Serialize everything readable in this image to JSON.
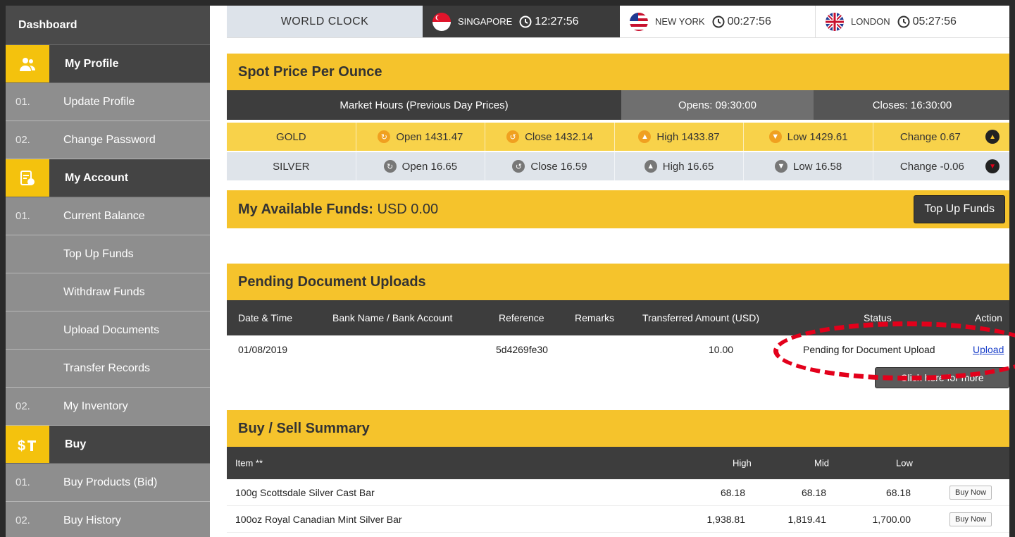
{
  "sidebar": {
    "dashboard": "Dashboard",
    "sections": [
      {
        "label": "My Profile",
        "icon": "user-group-icon"
      },
      {
        "label": "My Account",
        "icon": "account-document-icon"
      },
      {
        "label": "Buy",
        "icon": "dollar-bar-icon"
      }
    ],
    "profile_items": [
      {
        "num": "01.",
        "label": "Update Profile"
      },
      {
        "num": "02.",
        "label": "Change Password"
      }
    ],
    "account_items": [
      {
        "num": "01.",
        "label": "Current Balance"
      },
      {
        "num": "",
        "label": "Top Up Funds"
      },
      {
        "num": "",
        "label": "Withdraw Funds"
      },
      {
        "num": "",
        "label": "Upload Documents"
      },
      {
        "num": "",
        "label": "Transfer Records"
      },
      {
        "num": "02.",
        "label": "My Inventory"
      }
    ],
    "buy_items": [
      {
        "num": "01.",
        "label": "Buy Products (Bid)"
      },
      {
        "num": "02.",
        "label": "Buy History"
      }
    ]
  },
  "world_clock": {
    "title": "WORLD CLOCK",
    "cities": [
      {
        "name": "SINGAPORE",
        "time": "12:27:56"
      },
      {
        "name": "NEW YORK",
        "time": "00:27:56"
      },
      {
        "name": "LONDON",
        "time": "05:27:56"
      }
    ]
  },
  "spot": {
    "title": "Spot Price Per Ounce",
    "market_hours": "Market Hours (Previous Day Prices)",
    "opens": "Opens: 09:30:00",
    "closes": "Closes: 16:30:00",
    "gold": {
      "metal": "GOLD",
      "open": "Open 1431.47",
      "close": "Close 1432.14",
      "high": "High 1433.87",
      "low": "Low 1429.61",
      "change": "Change 0.67"
    },
    "silver": {
      "metal": "SILVER",
      "open": "Open 16.65",
      "close": "Close 16.59",
      "high": "High 16.65",
      "low": "Low 16.58",
      "change": "Change -0.06"
    }
  },
  "funds": {
    "label": "My Available Funds:",
    "value": "USD 0.00",
    "button": "Top Up Funds"
  },
  "pending": {
    "title": "Pending Document Uploads",
    "headers": [
      "Date & Time",
      "Bank Name / Bank Account",
      "Reference",
      "Remarks",
      "Transferred Amount (USD)",
      "Status",
      "Action"
    ],
    "row": {
      "date": "01/08/2019",
      "bank": "",
      "reference": "5d4269fe30",
      "remarks": "",
      "amount": "10.00",
      "status": "Pending for Document Upload",
      "action": "Upload"
    },
    "more_button": "Click here for more"
  },
  "buysell": {
    "title": "Buy / Sell Summary",
    "headers": [
      "Item **",
      "High",
      "Mid",
      "Low"
    ],
    "rows": [
      {
        "item": "100g Scottsdale Silver Cast Bar",
        "high": "68.18",
        "mid": "68.18",
        "low": "68.18",
        "action": "Buy Now"
      },
      {
        "item": "100oz Royal Canadian Mint Silver Bar",
        "high": "1,938.81",
        "mid": "1,819.41",
        "low": "1,700.00",
        "action": "Buy Now"
      }
    ]
  },
  "colors": {
    "accent": "#f5c32c",
    "dark": "#3d3d3d",
    "annotation": "#e3001b"
  }
}
